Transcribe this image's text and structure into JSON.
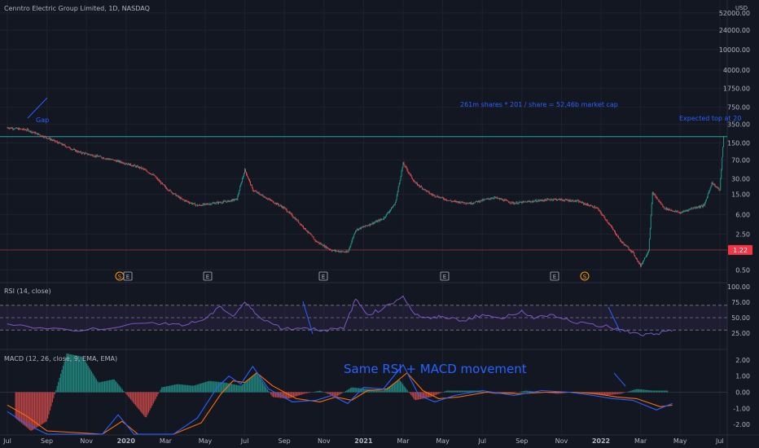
{
  "header": {
    "title": "Cenntro Electric Group Limited, 1D, NASDAQ",
    "currency": "USD"
  },
  "rsi_panel": {
    "title": "RSI (14, close)"
  },
  "macd_panel": {
    "title": "MACD (12, 26, close, 9, EMA, EMA)"
  },
  "annotations": {
    "gap": "Gap",
    "market_cap": "261m shares * 201 / share = 52,46b market cap",
    "expected_top": "Expected top at 20",
    "rsi_macd": "Same RSI + MACD movement"
  },
  "events": [
    "S",
    "E",
    "E",
    "E",
    "E",
    "E",
    "S"
  ],
  "price_badge": {
    "text": "1.22",
    "color": "#f23645"
  },
  "colors": {
    "up": "#26a69a",
    "down": "#ef5350",
    "rsi": "#7e57c2",
    "macd": "#2962ff",
    "signal": "#ff6d00",
    "annotation": "#2962ff",
    "level_line": "#26a69a"
  },
  "chart_data": [
    {
      "type": "candlestick",
      "scale": "log",
      "x_ticks": [
        "Jul",
        "Sep",
        "Nov",
        "2020",
        "Mar",
        "May",
        "Jul",
        "Sep",
        "Nov",
        "2021",
        "Mar",
        "May",
        "Jul",
        "Sep",
        "Nov",
        "2022",
        "Mar",
        "May",
        "Jul"
      ],
      "y_ticks": [
        "52000.00",
        "24000.00",
        "10000.00",
        "4000.00",
        "1750.00",
        "750.00",
        "350.00",
        "150.00",
        "70.00",
        "30.00",
        "15.00",
        "6.00",
        "2.50",
        "1.22",
        "0.50"
      ],
      "ylim": [
        0.35,
        60000
      ],
      "horizontal_levels": [
        200,
        1.22
      ],
      "price_path": [
        {
          "x": 0.0,
          "y": 300
        },
        {
          "x": 0.5,
          "y": 270
        },
        {
          "x": 1.0,
          "y": 190
        },
        {
          "x": 1.3,
          "y": 150
        },
        {
          "x": 1.8,
          "y": 100
        },
        {
          "x": 2.2,
          "y": 85
        },
        {
          "x": 2.6,
          "y": 72
        },
        {
          "x": 3.0,
          "y": 60
        },
        {
          "x": 3.4,
          "y": 48
        },
        {
          "x": 3.7,
          "y": 35
        },
        {
          "x": 4.0,
          "y": 20
        },
        {
          "x": 4.4,
          "y": 12
        },
        {
          "x": 4.8,
          "y": 9
        },
        {
          "x": 5.2,
          "y": 10
        },
        {
          "x": 5.6,
          "y": 11
        },
        {
          "x": 5.8,
          "y": 12
        },
        {
          "x": 6.0,
          "y": 45
        },
        {
          "x": 6.2,
          "y": 18
        },
        {
          "x": 6.6,
          "y": 12
        },
        {
          "x": 7.0,
          "y": 8
        },
        {
          "x": 7.4,
          "y": 4
        },
        {
          "x": 7.8,
          "y": 1.8
        },
        {
          "x": 8.2,
          "y": 1.2
        },
        {
          "x": 8.6,
          "y": 1.1
        },
        {
          "x": 8.8,
          "y": 3
        },
        {
          "x": 9.2,
          "y": 4
        },
        {
          "x": 9.5,
          "y": 5
        },
        {
          "x": 9.8,
          "y": 10
        },
        {
          "x": 10.0,
          "y": 60
        },
        {
          "x": 10.3,
          "y": 25
        },
        {
          "x": 10.7,
          "y": 15
        },
        {
          "x": 11.2,
          "y": 11
        },
        {
          "x": 11.7,
          "y": 10
        },
        {
          "x": 12.3,
          "y": 13
        },
        {
          "x": 12.8,
          "y": 10
        },
        {
          "x": 13.3,
          "y": 11
        },
        {
          "x": 13.8,
          "y": 12
        },
        {
          "x": 14.4,
          "y": 11
        },
        {
          "x": 14.9,
          "y": 8
        },
        {
          "x": 15.2,
          "y": 4
        },
        {
          "x": 15.5,
          "y": 1.8
        },
        {
          "x": 15.8,
          "y": 1.1
        },
        {
          "x": 16.0,
          "y": 0.6
        },
        {
          "x": 16.2,
          "y": 1.2
        },
        {
          "x": 16.3,
          "y": 16
        },
        {
          "x": 16.6,
          "y": 8
        },
        {
          "x": 17.0,
          "y": 6.5
        },
        {
          "x": 17.3,
          "y": 8
        },
        {
          "x": 17.6,
          "y": 9
        },
        {
          "x": 17.8,
          "y": 25
        },
        {
          "x": 18.0,
          "y": 18
        },
        {
          "x": 18.1,
          "y": 200
        }
      ]
    },
    {
      "type": "line",
      "name": "RSI",
      "y_ticks": [
        "100.00",
        "75.00",
        "50.00",
        "25.00"
      ],
      "ylim": [
        0,
        100
      ],
      "bands": [
        70,
        50,
        30
      ],
      "points": [
        {
          "x": 0.0,
          "y": 40
        },
        {
          "x": 1.0,
          "y": 32
        },
        {
          "x": 2.0,
          "y": 30
        },
        {
          "x": 3.0,
          "y": 38
        },
        {
          "x": 4.0,
          "y": 42
        },
        {
          "x": 4.5,
          "y": 38
        },
        {
          "x": 5.0,
          "y": 48
        },
        {
          "x": 5.4,
          "y": 68
        },
        {
          "x": 5.7,
          "y": 52
        },
        {
          "x": 6.0,
          "y": 75
        },
        {
          "x": 6.3,
          "y": 55
        },
        {
          "x": 6.7,
          "y": 40
        },
        {
          "x": 7.0,
          "y": 32
        },
        {
          "x": 7.5,
          "y": 34
        },
        {
          "x": 8.0,
          "y": 30
        },
        {
          "x": 8.5,
          "y": 32
        },
        {
          "x": 8.8,
          "y": 80
        },
        {
          "x": 9.1,
          "y": 55
        },
        {
          "x": 9.5,
          "y": 65
        },
        {
          "x": 10.0,
          "y": 85
        },
        {
          "x": 10.3,
          "y": 55
        },
        {
          "x": 10.7,
          "y": 48
        },
        {
          "x": 11.0,
          "y": 52
        },
        {
          "x": 11.5,
          "y": 45
        },
        {
          "x": 12.0,
          "y": 55
        },
        {
          "x": 12.5,
          "y": 48
        },
        {
          "x": 13.0,
          "y": 62
        },
        {
          "x": 13.3,
          "y": 48
        },
        {
          "x": 13.8,
          "y": 55
        },
        {
          "x": 14.2,
          "y": 45
        },
        {
          "x": 14.8,
          "y": 40
        },
        {
          "x": 15.2,
          "y": 35
        },
        {
          "x": 15.6,
          "y": 28
        },
        {
          "x": 16.0,
          "y": 22
        },
        {
          "x": 16.4,
          "y": 24
        },
        {
          "x": 16.8,
          "y": 28
        }
      ]
    },
    {
      "type": "line",
      "name": "MACD",
      "y_ticks": [
        "2.00",
        "1.00",
        "0.00",
        "-1.00",
        "-2.00"
      ],
      "ylim": [
        -2.6,
        2.6
      ],
      "series": [
        {
          "points": [
            {
              "x": 0.0,
              "y": -1.2
            },
            {
              "x": 0.5,
              "y": -2.0
            },
            {
              "x": 1.0,
              "y": -2.6
            },
            {
              "x": 2.4,
              "y": -2.6
            },
            {
              "x": 2.8,
              "y": -1.4
            },
            {
              "x": 3.2,
              "y": -2.6
            },
            {
              "x": 4.2,
              "y": -2.6
            },
            {
              "x": 4.8,
              "y": -1.6
            },
            {
              "x": 5.3,
              "y": 0.3
            },
            {
              "x": 5.6,
              "y": 1.0
            },
            {
              "x": 5.9,
              "y": 0.5
            },
            {
              "x": 6.2,
              "y": 1.6
            },
            {
              "x": 6.6,
              "y": 0.2
            },
            {
              "x": 7.2,
              "y": -0.6
            },
            {
              "x": 7.8,
              "y": -0.5
            },
            {
              "x": 8.2,
              "y": -0.2
            },
            {
              "x": 8.6,
              "y": -0.7
            },
            {
              "x": 9.0,
              "y": 0.3
            },
            {
              "x": 9.5,
              "y": 0.2
            },
            {
              "x": 10.0,
              "y": 1.7
            },
            {
              "x": 10.4,
              "y": -0.2
            },
            {
              "x": 10.8,
              "y": -0.6
            },
            {
              "x": 11.3,
              "y": -0.2
            },
            {
              "x": 12.0,
              "y": 0.1
            },
            {
              "x": 12.8,
              "y": -0.2
            },
            {
              "x": 13.5,
              "y": 0.1
            },
            {
              "x": 14.2,
              "y": 0.0
            },
            {
              "x": 14.8,
              "y": -0.2
            },
            {
              "x": 15.3,
              "y": -0.4
            },
            {
              "x": 15.8,
              "y": -0.5
            },
            {
              "x": 16.4,
              "y": -1.1
            },
            {
              "x": 16.8,
              "y": -0.7
            }
          ]
        },
        {
          "points": [
            {
              "x": 0.0,
              "y": -0.8
            },
            {
              "x": 0.5,
              "y": -1.5
            },
            {
              "x": 1.0,
              "y": -2.4
            },
            {
              "x": 2.4,
              "y": -2.6
            },
            {
              "x": 2.9,
              "y": -1.8
            },
            {
              "x": 3.3,
              "y": -2.6
            },
            {
              "x": 4.2,
              "y": -2.6
            },
            {
              "x": 4.9,
              "y": -1.9
            },
            {
              "x": 5.4,
              "y": -0.1
            },
            {
              "x": 5.7,
              "y": 0.7
            },
            {
              "x": 6.0,
              "y": 0.6
            },
            {
              "x": 6.3,
              "y": 1.2
            },
            {
              "x": 6.7,
              "y": 0.4
            },
            {
              "x": 7.3,
              "y": -0.4
            },
            {
              "x": 7.9,
              "y": -0.6
            },
            {
              "x": 8.3,
              "y": -0.3
            },
            {
              "x": 8.7,
              "y": -0.5
            },
            {
              "x": 9.1,
              "y": 0.1
            },
            {
              "x": 9.6,
              "y": 0.2
            },
            {
              "x": 10.1,
              "y": 1.2
            },
            {
              "x": 10.5,
              "y": 0.1
            },
            {
              "x": 10.9,
              "y": -0.4
            },
            {
              "x": 11.4,
              "y": -0.3
            },
            {
              "x": 12.1,
              "y": 0.0
            },
            {
              "x": 12.9,
              "y": -0.1
            },
            {
              "x": 13.6,
              "y": 0.0
            },
            {
              "x": 14.3,
              "y": 0.0
            },
            {
              "x": 14.9,
              "y": -0.1
            },
            {
              "x": 15.4,
              "y": -0.3
            },
            {
              "x": 15.9,
              "y": -0.4
            },
            {
              "x": 16.5,
              "y": -0.9
            },
            {
              "x": 16.8,
              "y": -0.8
            }
          ]
        }
      ],
      "histogram": [
        {
          "x": 0.2,
          "y": -1.6
        },
        {
          "x": 0.6,
          "y": -2.4
        },
        {
          "x": 1.0,
          "y": -1.8
        },
        {
          "x": 1.5,
          "y": 2.4
        },
        {
          "x": 1.9,
          "y": 2.2
        },
        {
          "x": 2.3,
          "y": 0.6
        },
        {
          "x": 2.7,
          "y": 0.8
        },
        {
          "x": 3.1,
          "y": -0.4
        },
        {
          "x": 3.5,
          "y": -1.6
        },
        {
          "x": 3.9,
          "y": 0.3
        },
        {
          "x": 4.3,
          "y": 0.5
        },
        {
          "x": 4.7,
          "y": 0.4
        },
        {
          "x": 5.1,
          "y": 0.7
        },
        {
          "x": 5.5,
          "y": 0.6
        },
        {
          "x": 5.9,
          "y": 0.4
        },
        {
          "x": 6.3,
          "y": 1.2
        },
        {
          "x": 6.7,
          "y": -0.3
        },
        {
          "x": 7.1,
          "y": -0.4
        },
        {
          "x": 7.5,
          "y": -0.1
        },
        {
          "x": 7.9,
          "y": 0.1
        },
        {
          "x": 8.3,
          "y": -0.3
        },
        {
          "x": 8.7,
          "y": 0.3
        },
        {
          "x": 9.1,
          "y": 0.2
        },
        {
          "x": 9.5,
          "y": 0.1
        },
        {
          "x": 9.9,
          "y": 0.8
        },
        {
          "x": 10.3,
          "y": -0.5
        },
        {
          "x": 10.7,
          "y": -0.3
        },
        {
          "x": 11.1,
          "y": 0.1
        },
        {
          "x": 11.5,
          "y": 0.1
        },
        {
          "x": 11.9,
          "y": 0.1
        },
        {
          "x": 12.3,
          "y": -0.1
        },
        {
          "x": 12.7,
          "y": -0.1
        },
        {
          "x": 13.1,
          "y": 0.1
        },
        {
          "x": 13.5,
          "y": 0.0
        },
        {
          "x": 13.9,
          "y": -0.1
        },
        {
          "x": 14.3,
          "y": 0.0
        },
        {
          "x": 14.7,
          "y": -0.1
        },
        {
          "x": 15.1,
          "y": -0.2
        },
        {
          "x": 15.5,
          "y": -0.1
        },
        {
          "x": 15.9,
          "y": 0.2
        },
        {
          "x": 16.3,
          "y": 0.1
        },
        {
          "x": 16.7,
          "y": 0.1
        }
      ]
    }
  ]
}
